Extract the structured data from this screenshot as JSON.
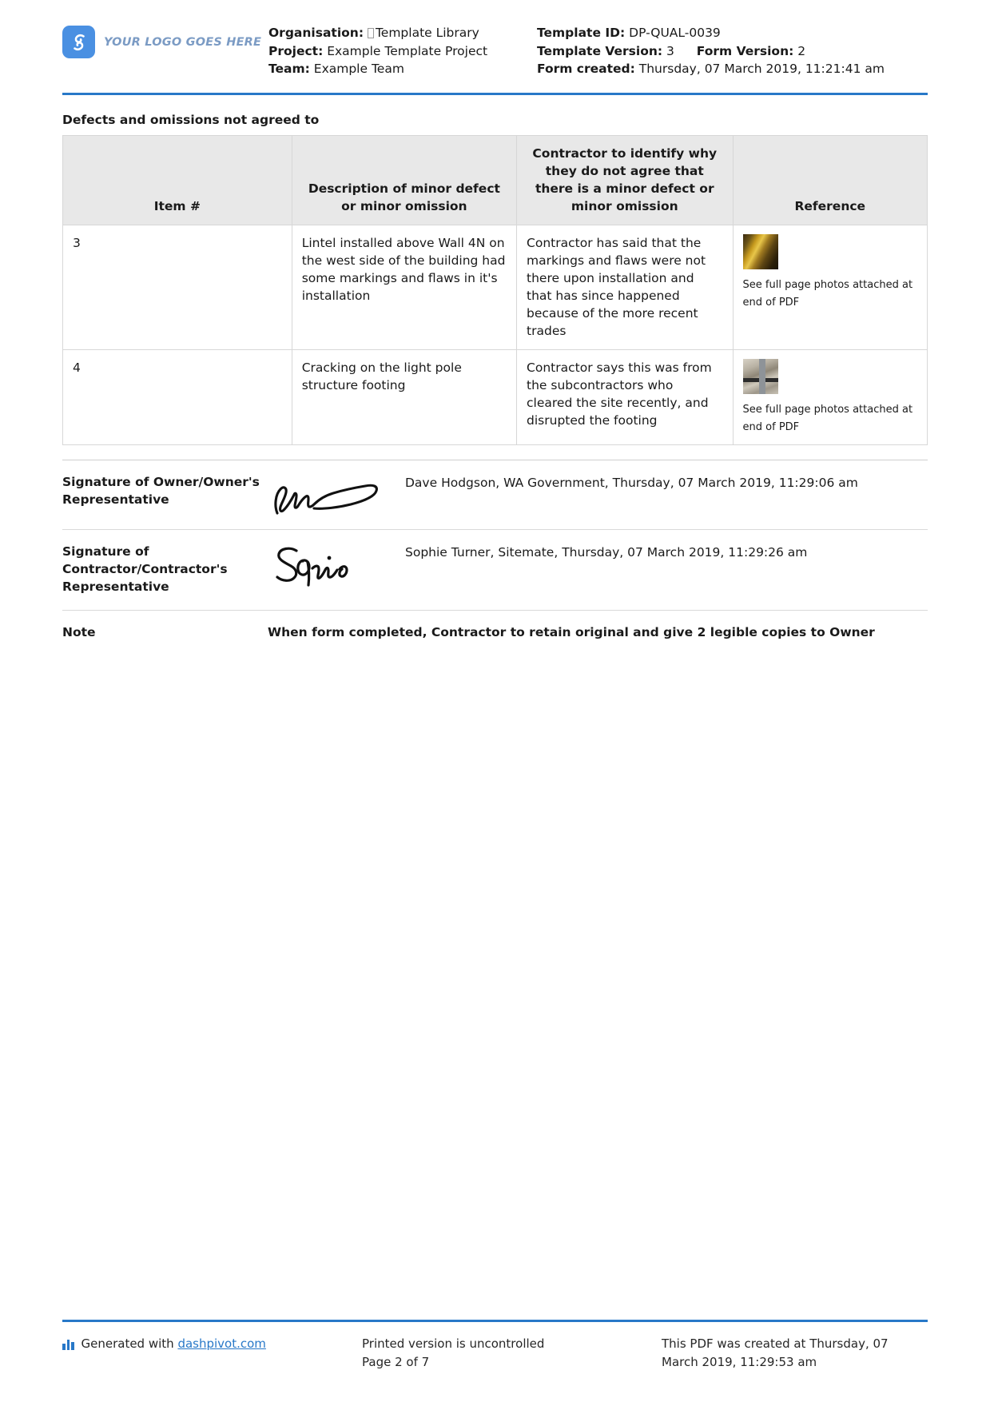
{
  "header": {
    "logo": {
      "icon": "dashpivot-logo-icon",
      "text": "YOUR LOGO GOES HERE"
    },
    "left": {
      "organisation_label": "Organisation:",
      "organisation_value": "Template Library",
      "project_label": "Project:",
      "project_value": "Example Template Project",
      "team_label": "Team:",
      "team_value": "Example Team"
    },
    "right": {
      "template_id_label": "Template ID:",
      "template_id_value": "DP-QUAL-0039",
      "template_version_label": "Template Version:",
      "template_version_value": "3",
      "form_version_label": "Form Version:",
      "form_version_value": "2",
      "form_created_label": "Form created:",
      "form_created_value": "Thursday, 07 March 2019, 11:21:41 am"
    }
  },
  "section": {
    "title": "Defects and omissions not agreed to"
  },
  "table": {
    "columns": [
      "Item #",
      "Description of minor defect or minor omission",
      "Contractor to identify why they do not agree that there is a minor defect or minor omission",
      "Reference"
    ],
    "rows": [
      {
        "item": "3",
        "description": "Lintel installed above Wall 4N on the west side of the building had some markings and flaws in it's installation",
        "contractor_reason": "Contractor has said that the markings and flaws were not there upon installation and that has since happened because of the more recent trades",
        "reference_note": "See full page photos attached at end of PDF",
        "reference_thumb": "photo-thumbnail-lintel"
      },
      {
        "item": "4",
        "description": "Cracking on the light pole structure footing",
        "contractor_reason": "Contractor says this was from the subcontractors who cleared the site recently, and disrupted the footing",
        "reference_note": "See full page photos attached at end of PDF",
        "reference_thumb": "photo-thumbnail-light-pole"
      }
    ]
  },
  "signatures": [
    {
      "label": "Signature of Owner/Owner's Representative",
      "signature_image": "signature-dave-hodgson",
      "meta": "Dave Hodgson, WA Government, Thursday, 07 March 2019, 11:29:06 am"
    },
    {
      "label": "Signature of Contractor/Contractor's Representative",
      "signature_image": "signature-sophie-turner",
      "meta": "Sophie Turner, Sitemate, Thursday, 07 March 2019, 11:29:26 am"
    }
  ],
  "note": {
    "label": "Note",
    "text": "When form completed, Contractor to retain original and give 2 legible copies to Owner"
  },
  "footer": {
    "generated_prefix": "Generated with ",
    "generated_link": "dashpivot.com",
    "uncontrolled": "Printed version is uncontrolled",
    "page": "Page 2 of 7",
    "pdf_created": "This PDF was created at Thursday, 07 March 2019, 11:29:53 am"
  },
  "colors": {
    "accent_blue": "#2878c8",
    "logo_blue": "#4a90e2",
    "logo_text": "#7b9bc4",
    "table_header_bg": "#e8e8e8",
    "border": "#d7d7d7"
  }
}
